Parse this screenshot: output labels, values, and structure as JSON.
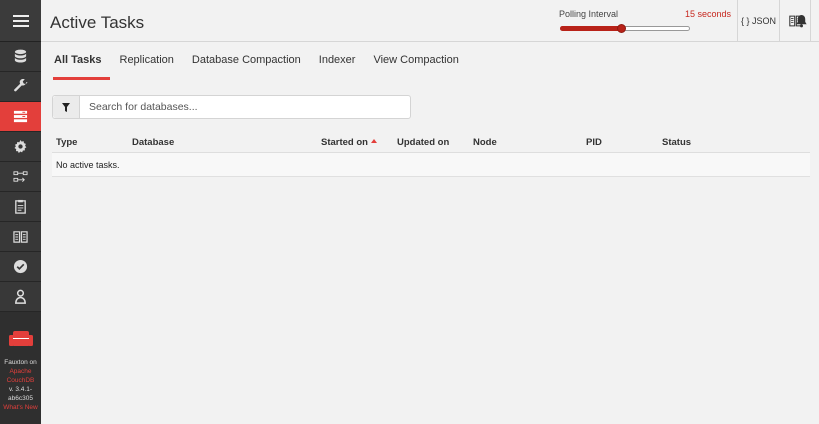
{
  "header": {
    "title": "Active Tasks",
    "polling": {
      "label": "Polling Interval",
      "value": "15 seconds",
      "fraction": 0.47
    },
    "json_label": "{ } JSON"
  },
  "tabs": [
    {
      "label": "All Tasks",
      "active": true
    },
    {
      "label": "Replication",
      "active": false
    },
    {
      "label": "Database Compaction",
      "active": false
    },
    {
      "label": "Indexer",
      "active": false
    },
    {
      "label": "View Compaction",
      "active": false
    }
  ],
  "search": {
    "placeholder": "Search for databases..."
  },
  "table": {
    "columns": [
      "Type",
      "Database",
      "Started on",
      "Updated on",
      "Node",
      "PID",
      "Status"
    ],
    "empty_message": "No active tasks."
  },
  "sidebar": {
    "items": [
      "databases-icon",
      "wrench-icon",
      "active-tasks-icon",
      "gear-icon",
      "replication-icon",
      "clipboard-icon",
      "book-icon",
      "checkmark-icon",
      "user-icon"
    ],
    "version": {
      "line1": "Fauxton on",
      "line2": "Apache",
      "line3": "CouchDB",
      "line4": "v. 3.4.1-",
      "line5": "ab6c305",
      "line6": "What's New"
    }
  },
  "colors": {
    "accent": "#e33f3b",
    "sidebar": "#2f2f2f",
    "slider": "#b82218"
  }
}
